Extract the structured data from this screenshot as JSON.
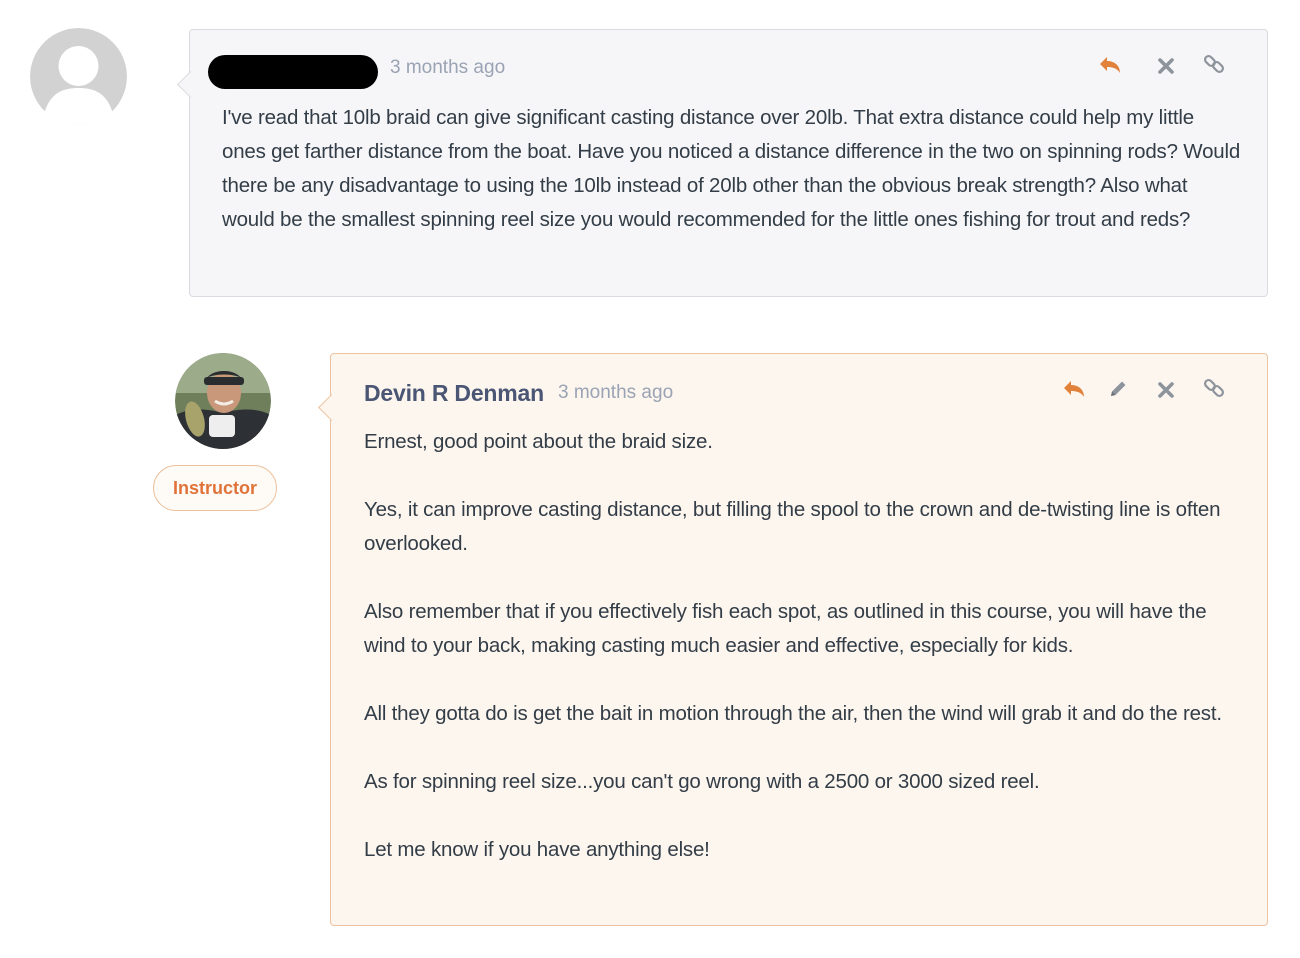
{
  "comments": [
    {
      "author_redacted": true,
      "timestamp": "3 months ago",
      "body": "I've read that 10lb braid can give significant casting distance over 20lb. That extra distance could help my little ones get farther distance from the boat. Have you noticed a distance difference in the two on spinning rods? Would there be any disadvantage to using the 10lb instead of 20lb other than the obvious break strength? Also what would be the smallest spinning  reel size you would recommended for the little ones fishing for trout and reds?",
      "actions": [
        "reply-icon",
        "delete-icon",
        "link-icon"
      ]
    },
    {
      "author": "Devin R Denman",
      "badge": "Instructor",
      "timestamp": "3 months ago",
      "paragraphs": [
        "Ernest, good point about the braid size.",
        "Yes, it can improve casting distance, but filling the spool to the crown and de-twisting line is often overlooked.",
        "Also remember that if you effectively fish each spot, as outlined in this course, you will have the wind to your back, making casting much easier and effective, especially for kids.",
        "All they gotta do is get the bait in motion through the air, then the wind will grab it and do the rest.",
        "As for spinning reel size...you can't go wrong with a 2500 or 3000 sized reel.",
        "Let me know if you have anything else!"
      ],
      "actions": [
        "reply-icon",
        "edit-icon",
        "delete-icon",
        "link-icon"
      ]
    }
  ],
  "colors": {
    "accent_orange": "#e2823a",
    "icon_gray": "#8e949c",
    "author_blue": "#4a5673",
    "instructor_bubble_bg": "#fdf6ef",
    "instructor_bubble_border": "#ecc3a1",
    "student_bubble_bg": "#f6f6f8",
    "student_bubble_border": "#d9dbe0"
  }
}
